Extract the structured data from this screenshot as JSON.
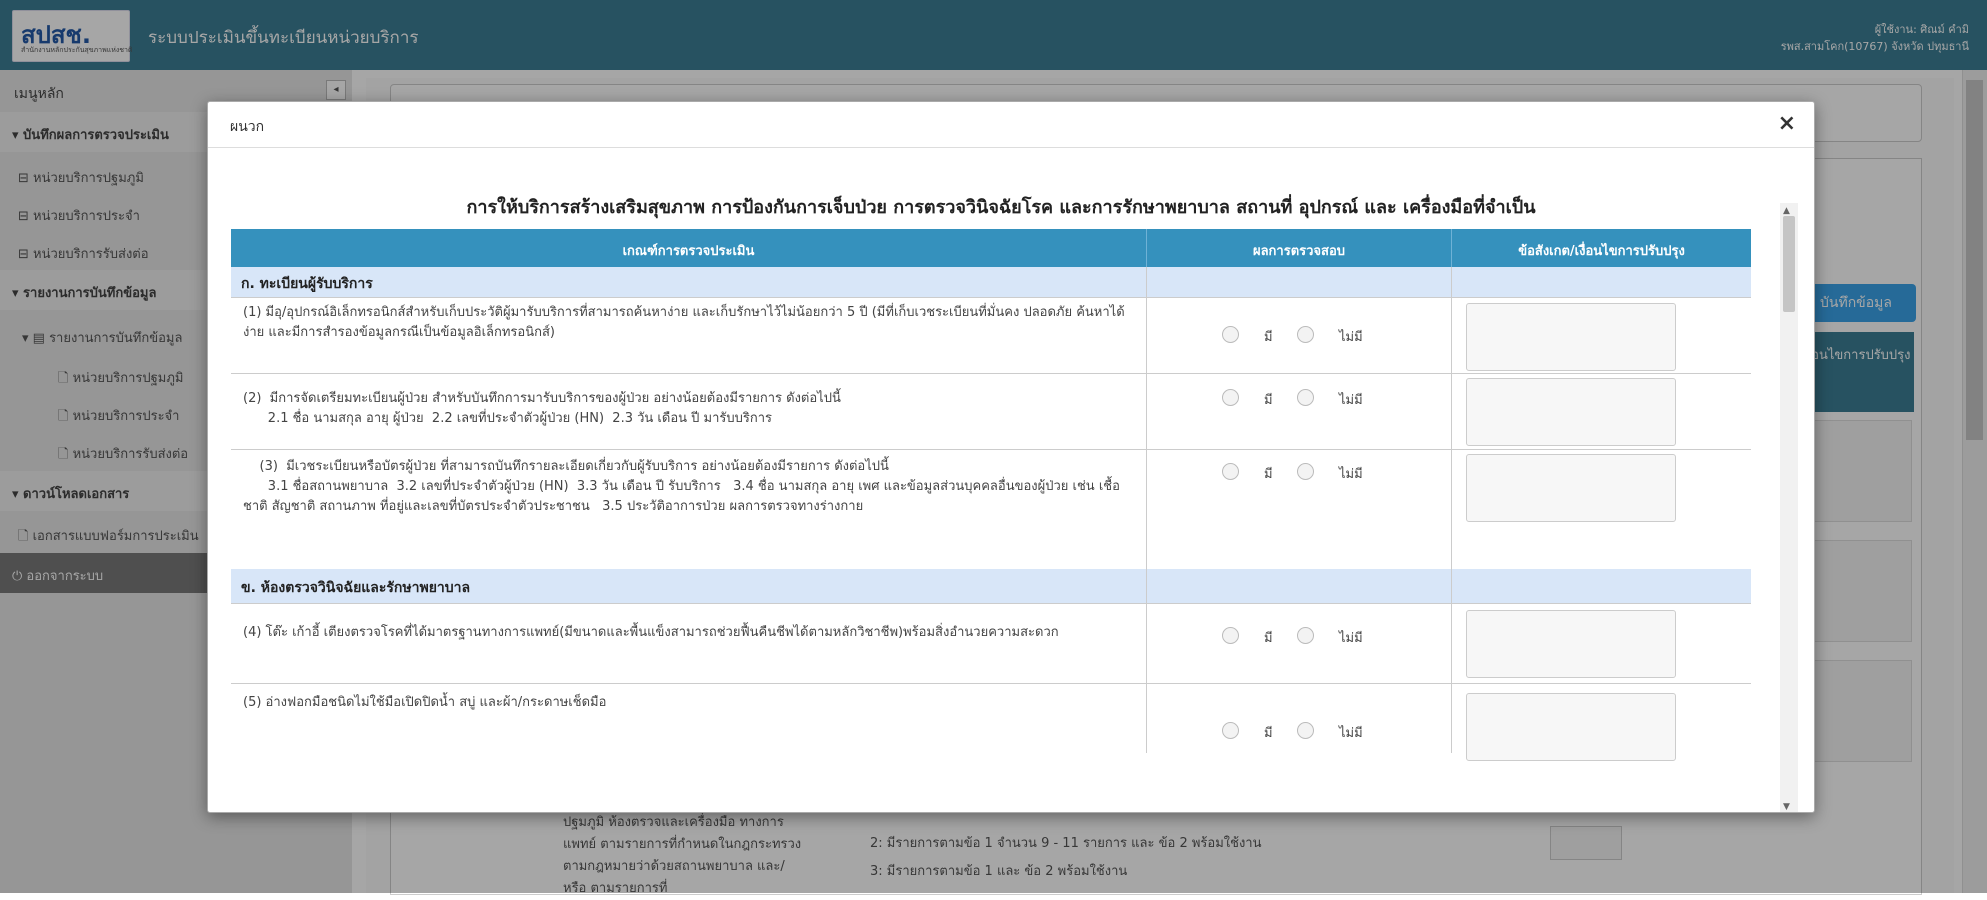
{
  "header": {
    "logo_text": "สปสช.",
    "logo_sub": "สำนักงานหลักประกันสุขภาพแห่งชาติ",
    "title": "ระบบประเมินขึ้นทะเบียนหน่วยบริการ",
    "user_line": "ผู้ใช้งาน: ศิณม์ คำมิ",
    "org_line": "รพส.สามโคก(10767)   จังหวัด ปทุมธานี"
  },
  "sidebar": {
    "title": "เมนูหลัก",
    "toggle": "◂",
    "items": [
      {
        "label": "▾  บันทึกผลการตรวจประเมิน"
      },
      {
        "label": "⊟  หน่วยบริการปฐมภูมิ"
      },
      {
        "label": "⊟  หน่วยบริการประจำ"
      },
      {
        "label": "⊟  หน่วยบริการรับส่งต่อ"
      },
      {
        "label": "▾  รายงานการบันทึกข้อมูล"
      },
      {
        "label": "▾ ▤ รายงานการบันทึกข้อมูล"
      },
      {
        "label": "🗋  หน่วยบริการปฐมภูมิ"
      },
      {
        "label": "🗋  หน่วยบริการประจำ"
      },
      {
        "label": "🗋  หน่วยบริการรับส่งต่อ"
      },
      {
        "label": "▾  ดาวน์โหลดเอกสาร"
      },
      {
        "label": "🗋  เอกสารแบบฟอร์มการประเมิน"
      },
      {
        "label": "⏻  ออกจากระบบ"
      }
    ]
  },
  "background": {
    "save_button": "บันทึกข้อมูล",
    "header_fragment": "/เงื่อนไขการปรับปรุง",
    "row_text": "ปฐมภูมิ ห้องตรวจและเครื่องมือ ทางการแพทย์ ตามรายการที่กำหนดในกฎกระทรวงตามกฎหมายว่าด้วยสถานพยาบาล และ/หรือ ตามรายการที่",
    "options": [
      "2: มีรายการตามข้อ 1 จำนวน 9 - 11 รายการ และ ข้อ 2 พร้อมใช้งาน",
      "3: มีรายการตามข้อ 1 และ ข้อ 2 พร้อมใช้งาน"
    ]
  },
  "modal": {
    "title": "ผนวก",
    "close": "×",
    "heading": "การให้บริการสร้างเสริมสุขภาพ การป้องกันการเจ็บป่วย การตรวจวินิจฉัยโรค และการรักษาพยาบาล สถานที่ อุปกรณ์ และ เครื่องมือที่จำเป็น",
    "columns": [
      "เกณฑ์การตรวจประเมิน",
      "ผลการตรวจสอบ",
      "ข้อสังเกต/เงื่อนไขการปรับปรุง"
    ],
    "option_yes": "มี",
    "option_no": "ไม่มี",
    "sections": [
      {
        "title": "ก. ทะเบียนผู้รับบริการ"
      },
      {
        "title": "ข. ห้องตรวจวินิจฉัยและรักษาพยาบาล"
      }
    ],
    "items": [
      {
        "text": "(1) มีอุ/อุปกรณ์อิเล็กทรอนิกส์สำหรับเก็บประวัติผู้มารับบริการที่สามารถค้นหาง่าย และเก็บรักษาไว้ไม่น้อยกว่า 5 ปี (มีที่เก็บเวชระเบียนที่มั่นคง ปลอดภัย ค้นหาได้ง่าย และมีการสำรองข้อมูลกรณีเป็นข้อมูลอิเล็กทรอนิกส์)"
      },
      {
        "text": "(2)  มีการจัดเตรียมทะเบียนผู้ป่วย สำหรับบันทึกการมารับบริการของผู้ป่วย อย่างน้อยต้องมีรายการ ดังต่อไปนี้\n      2.1 ชื่อ นามสกุล อายุ ผู้ป่วย  2.2 เลขที่ประจำตัวผู้ป่วย (HN)  2.3 วัน เดือน ปี มารับบริการ"
      },
      {
        "text": "    (3)  มีเวชระเบียนหรือบัตรผู้ป่วย ที่สามารถบันทึกรายละเอียดเกี่ยวกับผู้รับบริการ อย่างน้อยต้องมีรายการ ดังต่อไปนี้\n      3.1 ชื่อสถานพยาบาล  3.2 เลขที่ประจำตัวผู้ป่วย (HN)  3.3 วัน เดือน ปี รับบริการ   3.4 ชื่อ นามสกุล อายุ เพศ และข้อมูลส่วนบุคคลอื่นของผู้ป่วย เช่น เชื้อชาติ สัญชาติ สถานภาพ ที่อยู่และเลขที่บัตรประจำตัวประชาชน   3.5 ประวัติอาการป่วย ผลการตรวจทางร่างกาย"
      },
      {
        "text": "(4) โต๊ะ เก้าอี้ เตียงตรวจโรคที่ได้มาตรฐานทางการแพทย์(มีขนาดและพื้นแข็งสามารถช่วยฟื้นคืนชีพได้ตามหลักวิชาชีพ)พร้อมสิ่งอำนวยความสะดวก"
      },
      {
        "text": "(5) อ่างฟอกมือชนิดไม่ใช้มือเปิดปิดน้ำ สบู่ และผ้า/กระดาษเช็ดมือ"
      }
    ]
  }
}
